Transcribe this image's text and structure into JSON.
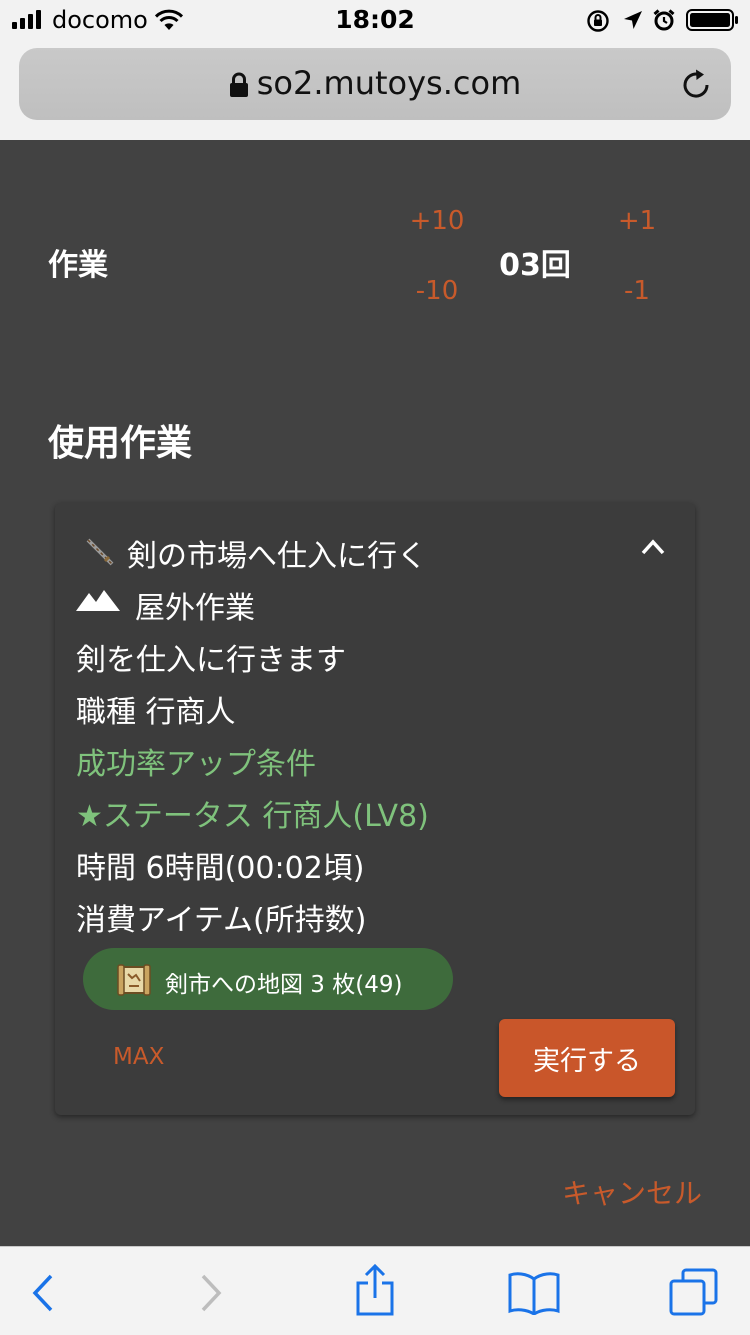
{
  "status_bar": {
    "carrier": "docomo",
    "time": "18:02"
  },
  "browser": {
    "url": "so2.mutoys.com"
  },
  "quantity": {
    "label": "作業",
    "value": "03回",
    "plus_ten": "+10",
    "plus_one": "+1",
    "minus_ten": "-10",
    "minus_one": "-1"
  },
  "section_title": "使用作業",
  "task": {
    "title": "剣の市場へ仕入に行く",
    "type": "屋外作業",
    "description": "剣を仕入に行きます",
    "job": "職種 行商人",
    "bonus_heading": "成功率アップ条件",
    "bonus_condition": "★ステータス 行商人(LV8)",
    "duration": "時間 6時間(00:02頃)",
    "consumed_heading": "消費アイテム(所持数)",
    "item_chip": "剣市への地図 3 枚(49)",
    "max_label": "MAX",
    "execute_label": "実行する"
  },
  "cancel_label": "キャンセル",
  "colors": {
    "page_bg": "#424242",
    "card_bg": "#3c3c3c",
    "accent_orange": "#c85a2b",
    "accent_green": "#7fc27c",
    "chip_bg": "#3e6b3c",
    "ios_blue": "#1a73e8"
  }
}
